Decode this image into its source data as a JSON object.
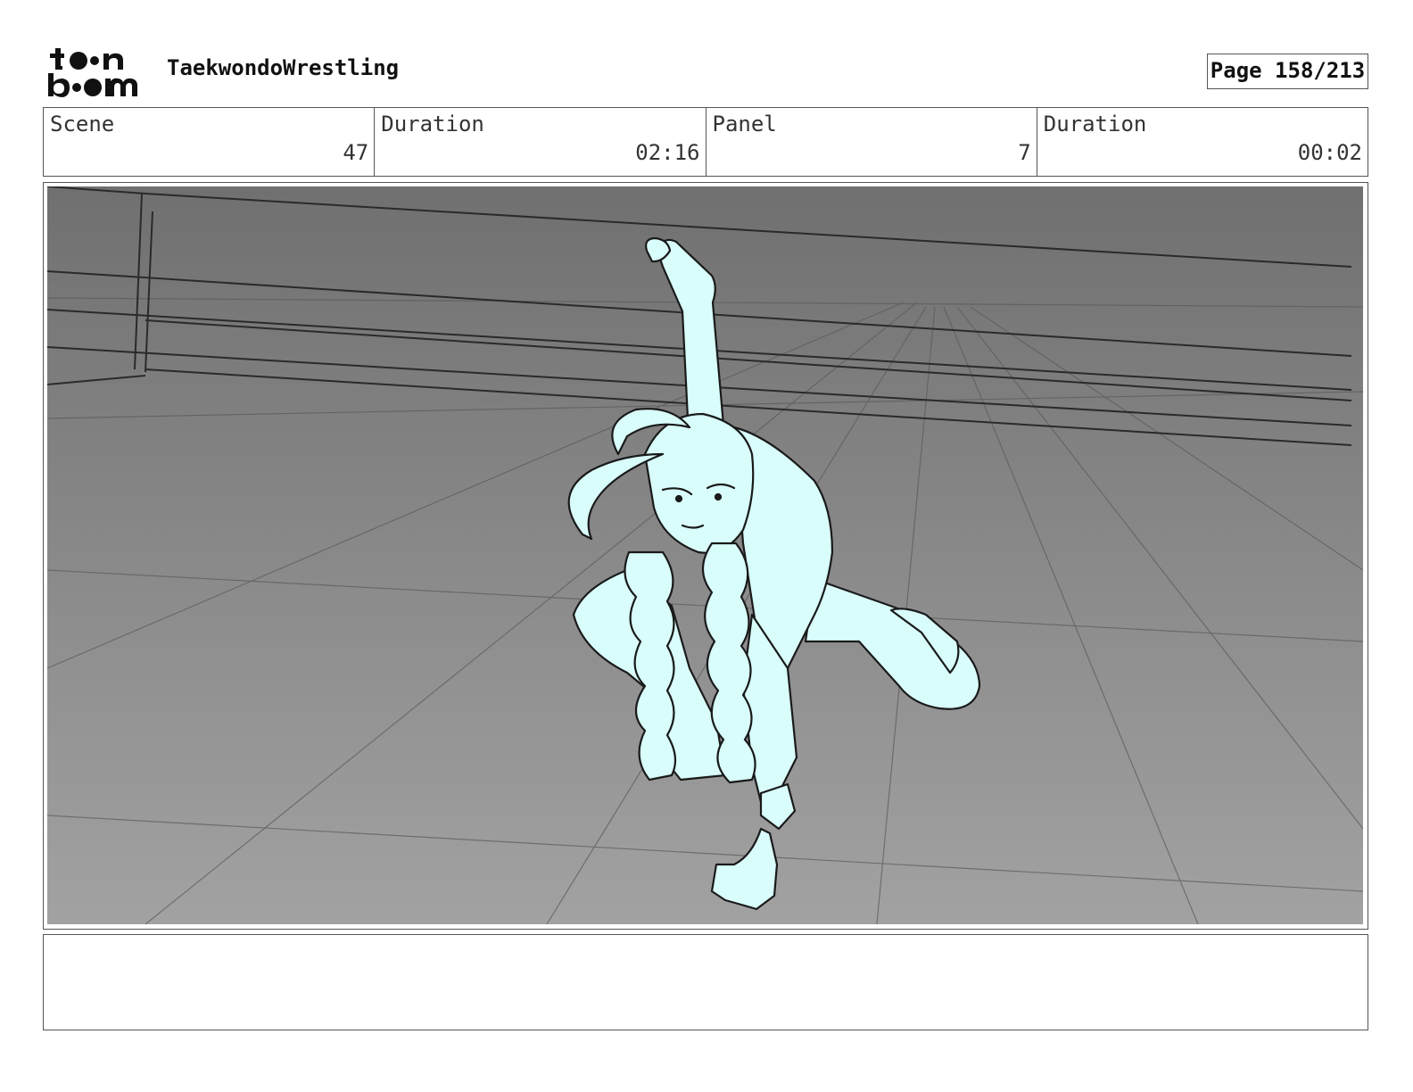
{
  "header": {
    "logo_line1": "toon",
    "logo_line2": "boom",
    "project_title": "TaekwondoWrestling",
    "page_label": "Page 158/213"
  },
  "info": {
    "scene_label": "Scene",
    "scene_value": "47",
    "scene_duration_label": "Duration",
    "scene_duration_value": "02:16",
    "panel_label": "Panel",
    "panel_value": "7",
    "panel_duration_label": "Duration",
    "panel_duration_value": "00:02"
  },
  "colors": {
    "character_fill": "#d8fdfb",
    "background_top": "#707070",
    "background_bottom": "#a2a2a2",
    "line": "#1a1a1a"
  },
  "notes": ""
}
